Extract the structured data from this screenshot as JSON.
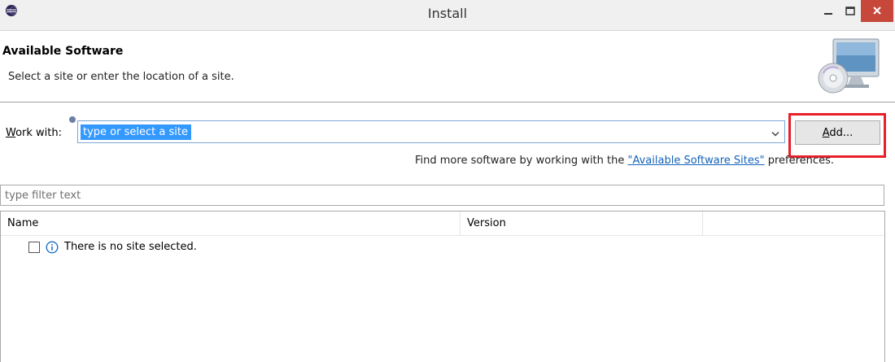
{
  "window": {
    "title": "Install",
    "icons": {
      "app": "eclipse-icon",
      "minimize": "minimize-icon",
      "maximize": "maximize-icon",
      "close": "close-icon"
    }
  },
  "header": {
    "title": "Available Software",
    "description": "Select a site or enter the location of a site."
  },
  "work_with": {
    "label_accel": "W",
    "label_rest": "ork with:",
    "value": "type or select a site",
    "add_accel": "A",
    "add_rest": "dd...",
    "find_more_prefix": "Find more software by working with the ",
    "find_more_link": "\"Available Software Sites\"",
    "find_more_suffix": " preferences."
  },
  "filter": {
    "placeholder": "type filter text"
  },
  "table": {
    "columns": [
      "Name",
      "Version"
    ],
    "empty_message": "There is no site selected."
  },
  "colors": {
    "close_button": "#c7483b",
    "selection": "#3399ff",
    "link": "#1463b9",
    "highlight": "#e8202a"
  }
}
